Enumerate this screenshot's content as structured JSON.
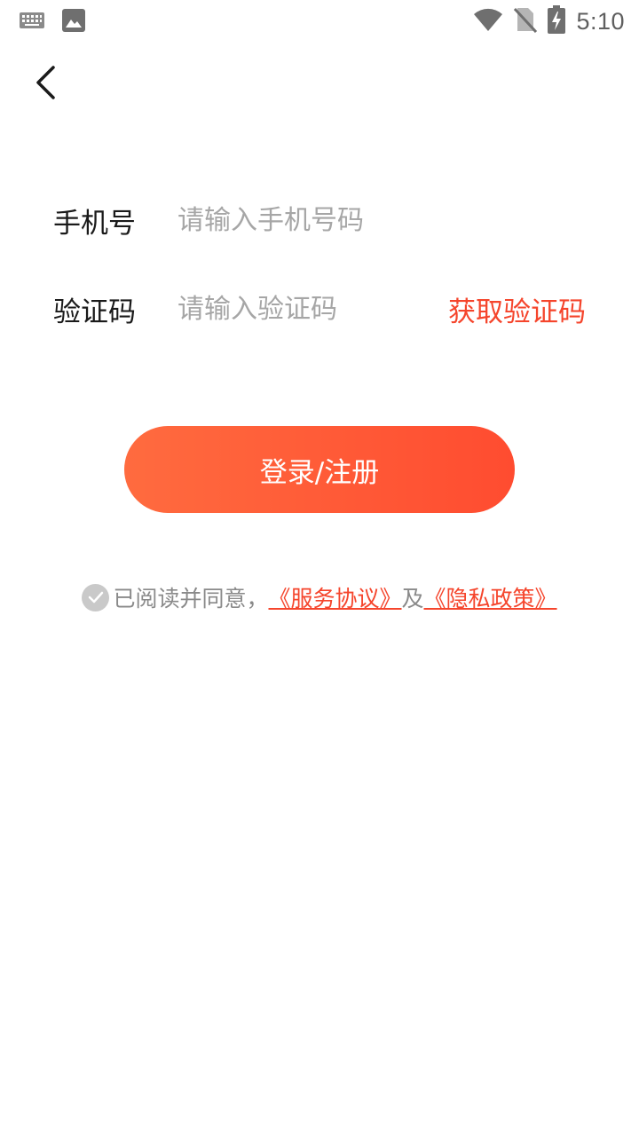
{
  "status_bar": {
    "time": "5:10",
    "left_icons": [
      "keyboard-icon",
      "image-icon"
    ],
    "right_icons": [
      "wifi-icon",
      "no-sim-icon",
      "battery-charging-icon"
    ]
  },
  "nav": {
    "back_icon": "chevron-left-icon"
  },
  "form": {
    "phone_label": "手机号",
    "phone_placeholder": "请输入手机号码",
    "code_label": "验证码",
    "code_placeholder": "请输入验证码",
    "get_code_label": "获取验证码"
  },
  "login_button": {
    "label": "登录/注册"
  },
  "agreement": {
    "prefix": "已阅读并同意，",
    "service_link": "《服务协议》",
    "and_text": "及",
    "privacy_link": "《隐私政策》"
  },
  "colors": {
    "accent": "#f5452c",
    "button_gradient_start": "#ff6b3f",
    "button_gradient_end": "#ff4c30",
    "placeholder": "#a6a6a6",
    "checkbox_gray": "#c9c9c9"
  }
}
